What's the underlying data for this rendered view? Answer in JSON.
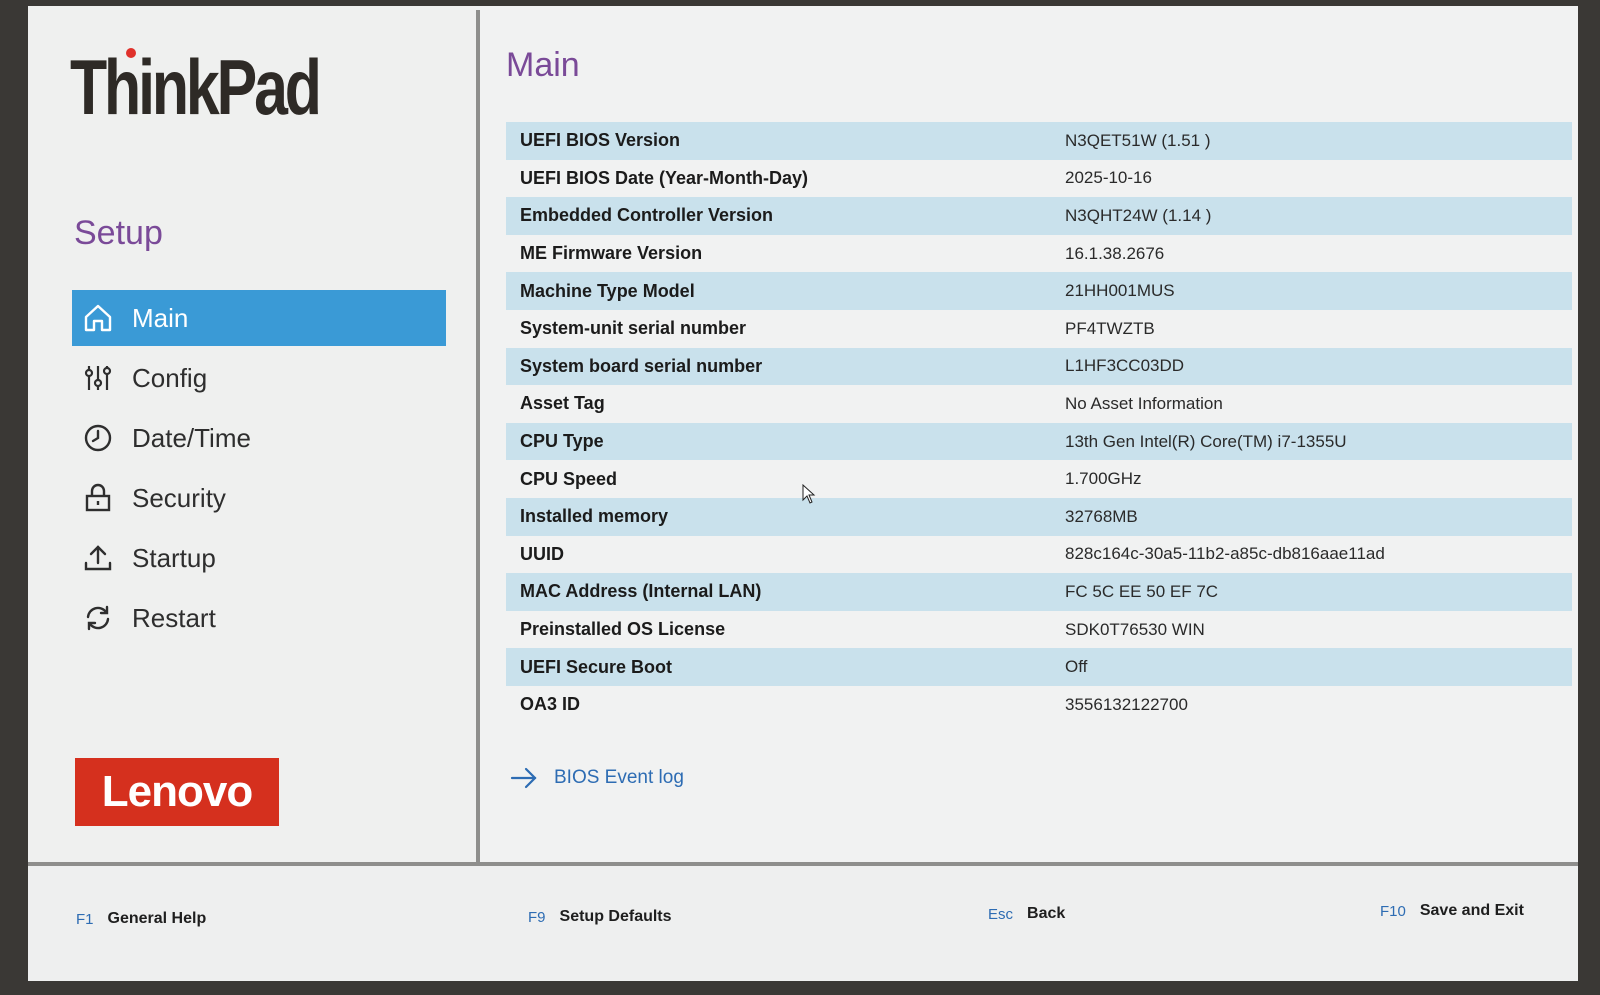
{
  "sidebar": {
    "brand": "ThinkPad",
    "title": "Setup",
    "items": [
      {
        "label": "Main",
        "icon": "home-icon",
        "active": true
      },
      {
        "label": "Config",
        "icon": "sliders-icon"
      },
      {
        "label": "Date/Time",
        "icon": "clock-icon"
      },
      {
        "label": "Security",
        "icon": "lock-icon"
      },
      {
        "label": "Startup",
        "icon": "upload-icon"
      },
      {
        "label": "Restart",
        "icon": "refresh-icon"
      }
    ],
    "logo": "Lenovo"
  },
  "main": {
    "title": "Main",
    "rows": [
      {
        "label": "UEFI BIOS Version",
        "value": "N3QET51W (1.51 )"
      },
      {
        "label": "UEFI BIOS Date (Year-Month-Day)",
        "value": "2025-10-16"
      },
      {
        "label": "Embedded Controller Version",
        "value": "N3QHT24W (1.14 )"
      },
      {
        "label": "ME Firmware Version",
        "value": "16.1.38.2676"
      },
      {
        "label": "Machine Type Model",
        "value": "21HH001MUS"
      },
      {
        "label": "System-unit serial number",
        "value": "PF4TWZTB"
      },
      {
        "label": "System board serial number",
        "value": "L1HF3CC03DD"
      },
      {
        "label": "Asset Tag",
        "value": "No Asset Information"
      },
      {
        "label": "CPU Type",
        "value": "13th Gen Intel(R) Core(TM) i7-1355U"
      },
      {
        "label": "CPU Speed",
        "value": "1.700GHz"
      },
      {
        "label": "Installed memory",
        "value": "32768MB"
      },
      {
        "label": "UUID",
        "value": "828c164c-30a5-11b2-a85c-db816aae11ad"
      },
      {
        "label": "MAC Address (Internal LAN)",
        "value": "FC 5C EE 50 EF 7C"
      },
      {
        "label": "Preinstalled OS License",
        "value": "SDK0T76530 WIN"
      },
      {
        "label": "UEFI Secure Boot",
        "value": "Off"
      },
      {
        "label": "OA3 ID",
        "value": "3556132122700"
      }
    ],
    "event_log_label": "BIOS Event log"
  },
  "footer": {
    "keys": [
      {
        "key": "F1",
        "label": "General Help"
      },
      {
        "key": "F9",
        "label": "Setup Defaults"
      },
      {
        "key": "Esc",
        "label": "Back"
      },
      {
        "key": "F10",
        "label": "Save and Exit"
      }
    ]
  },
  "colors": {
    "accent_purple": "#7a4a98",
    "active_blue": "#3a9ad6",
    "row_shade": "#c9e1ec",
    "link_blue": "#2d6cb3",
    "lenovo_red": "#d5301e"
  }
}
